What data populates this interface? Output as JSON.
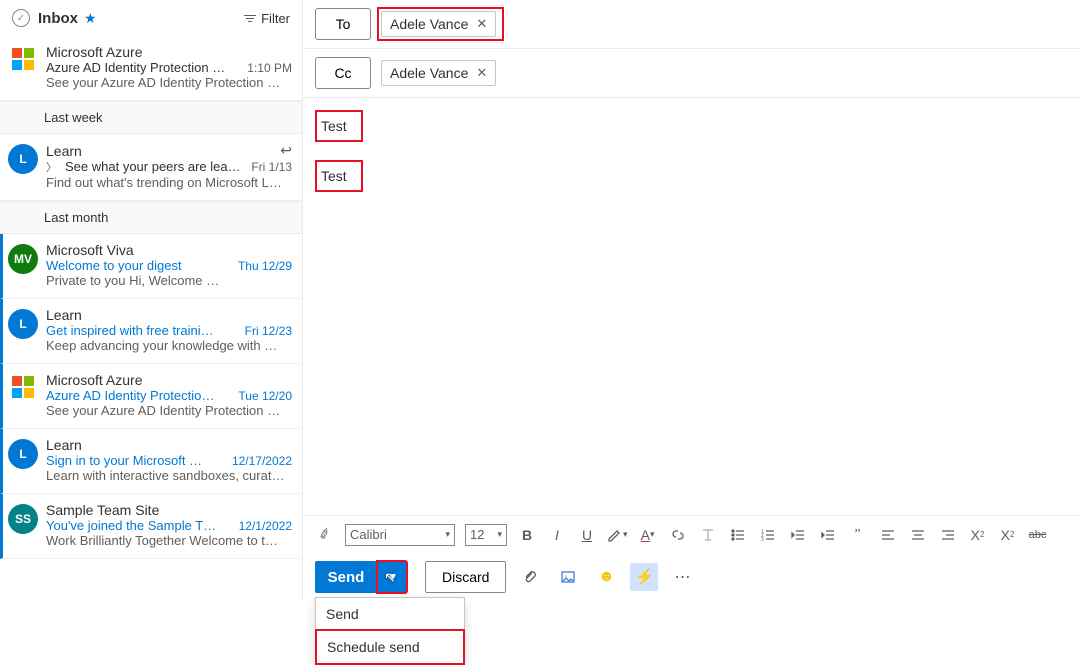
{
  "header": {
    "title": "Inbox",
    "filter_label": "Filter"
  },
  "groups": {
    "last_week": "Last week",
    "last_month": "Last month"
  },
  "emails": [
    {
      "from": "Microsoft Azure",
      "subject": "Azure AD Identity Protection …",
      "date": "1:10 PM",
      "preview": "See your Azure AD Identity Protection …",
      "avatar": "mslogo",
      "unread": false,
      "blue": false,
      "date_gray": true
    },
    {
      "from": "Learn",
      "subject": "See what your peers are lea…",
      "date": "Fri 1/13",
      "preview": "Find out what's trending on Microsoft L…",
      "avatar": "L",
      "avatar_bg": "#0078d4",
      "unread": false,
      "blue": false,
      "chev": true,
      "reply": true,
      "date_gray": true
    },
    {
      "from": "Microsoft Viva",
      "subject": "Welcome to your digest",
      "date": "Thu 12/29",
      "preview": "Private to you Hi,             Welcome …",
      "avatar": "MV",
      "avatar_bg": "#107c10",
      "unread": true,
      "blue": true
    },
    {
      "from": "Learn",
      "subject": "Get inspired with free traini…",
      "date": "Fri 12/23",
      "preview": "Keep advancing your knowledge with …",
      "avatar": "L",
      "avatar_bg": "#0078d4",
      "unread": true,
      "blue": true
    },
    {
      "from": "Microsoft Azure",
      "subject": "Azure AD Identity Protectio…",
      "date": "Tue 12/20",
      "preview": "See your Azure AD Identity Protection …",
      "avatar": "mslogo",
      "unread": true,
      "blue": true
    },
    {
      "from": "Learn",
      "subject": "Sign in to your Microsoft …",
      "date": "12/17/2022",
      "preview": "Learn with interactive sandboxes, curat…",
      "avatar": "L",
      "avatar_bg": "#0078d4",
      "unread": true,
      "blue": true
    },
    {
      "from": "Sample Team Site",
      "subject": "You've joined the Sample T…",
      "date": "12/1/2022",
      "preview": "Work Brilliantly Together Welcome to t…",
      "avatar": "SS",
      "avatar_bg": "#038387",
      "unread": true,
      "blue": true
    }
  ],
  "compose": {
    "to_label": "To",
    "cc_label": "Cc",
    "to_chip": "Adele Vance",
    "cc_chip": "Adele Vance",
    "subject": "Test",
    "body": "Test"
  },
  "toolbar": {
    "font_name": "Calibri",
    "font_size": "12"
  },
  "actions": {
    "send": "Send",
    "discard": "Discard",
    "menu_send": "Send",
    "menu_schedule": "Schedule send"
  },
  "colors": {
    "primary": "#0078d4",
    "highlight_red": "#e81123"
  }
}
